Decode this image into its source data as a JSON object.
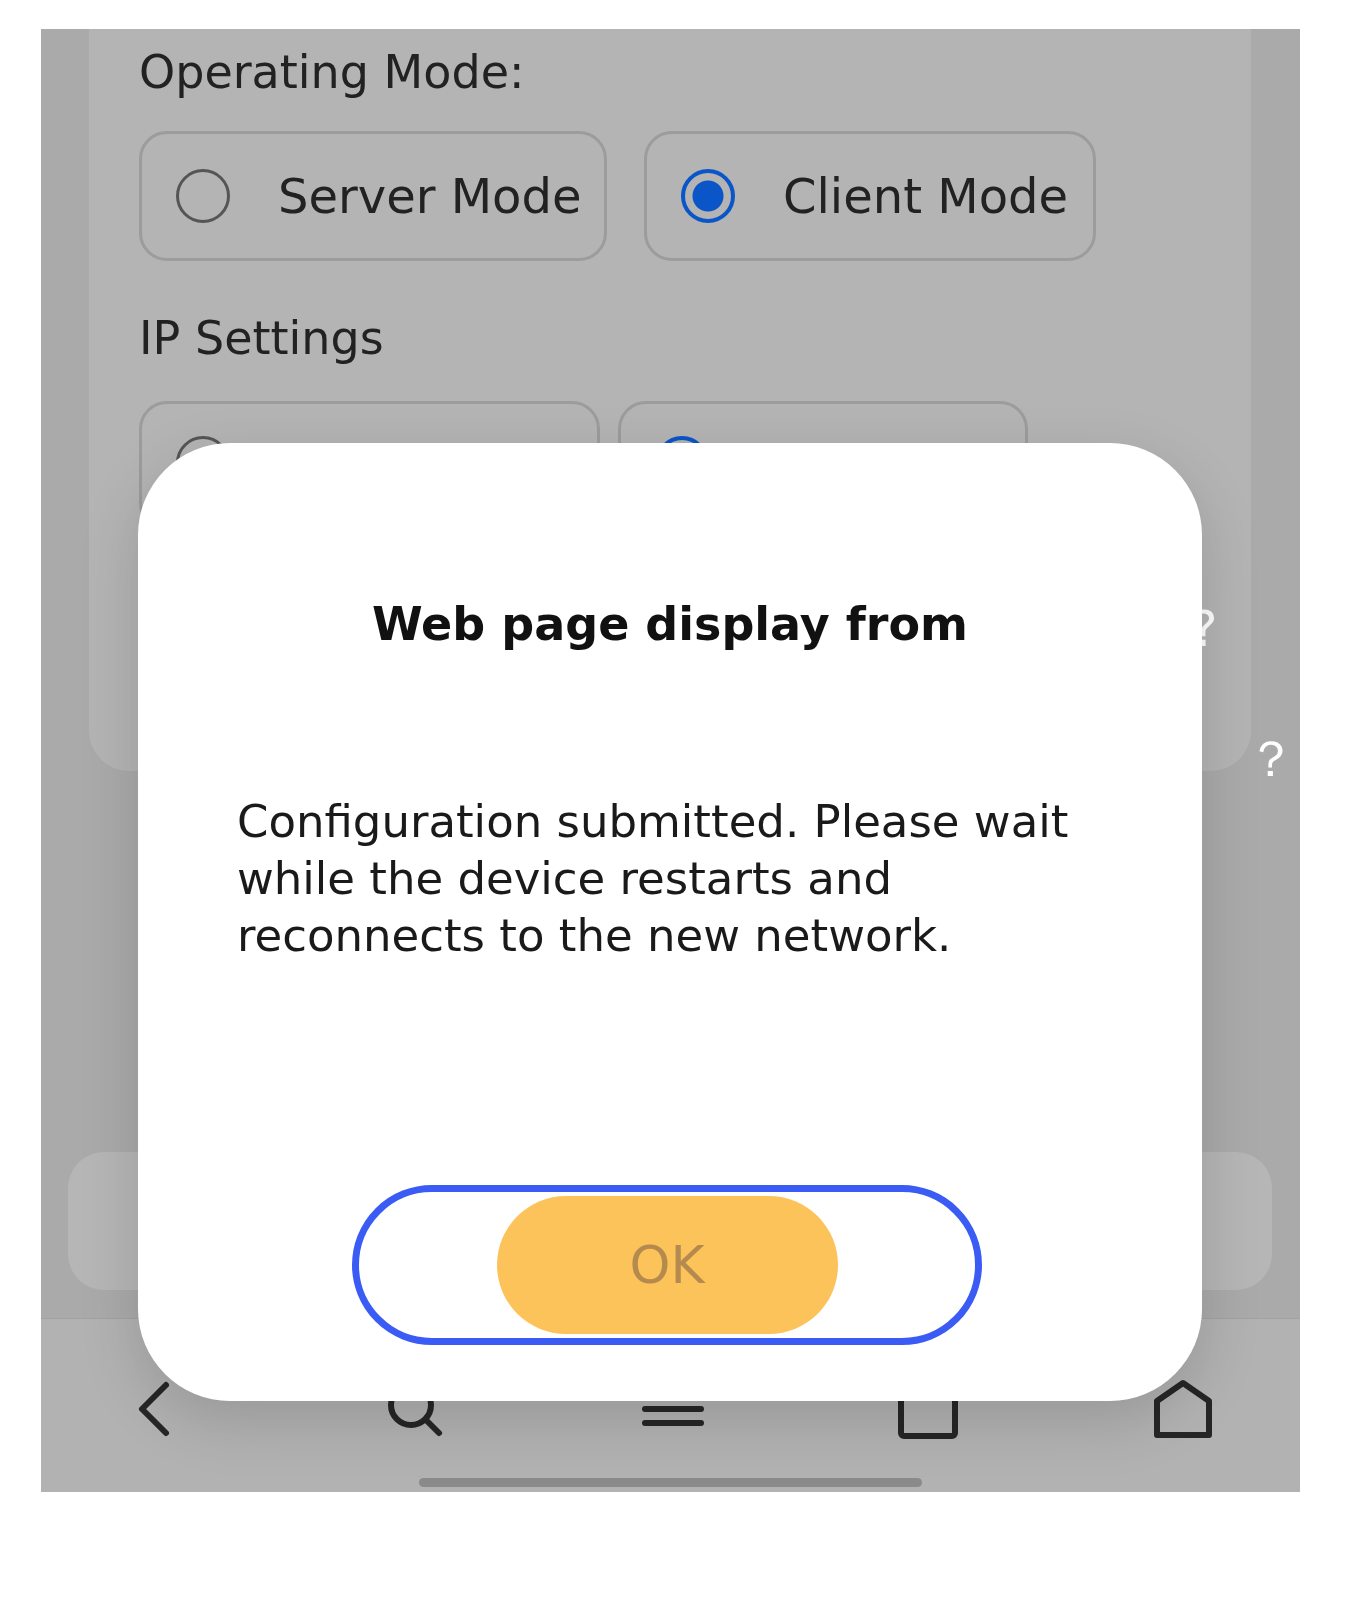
{
  "operating_mode": {
    "label": "Operating Mode:",
    "options": [
      {
        "label": "Server Mode",
        "selected": false
      },
      {
        "label": "Client Mode",
        "selected": true
      }
    ]
  },
  "ip_settings": {
    "label": "IP Settings",
    "options": [
      {
        "selected": false
      },
      {
        "selected": true
      }
    ]
  },
  "background_text": [
    "?",
    "？"
  ],
  "dialog": {
    "title": "Web page display from",
    "message": "Configuration submitted. Please wait while the device restarts and reconnects to the new network.",
    "button": {
      "label": "OK",
      "focused": true
    }
  }
}
